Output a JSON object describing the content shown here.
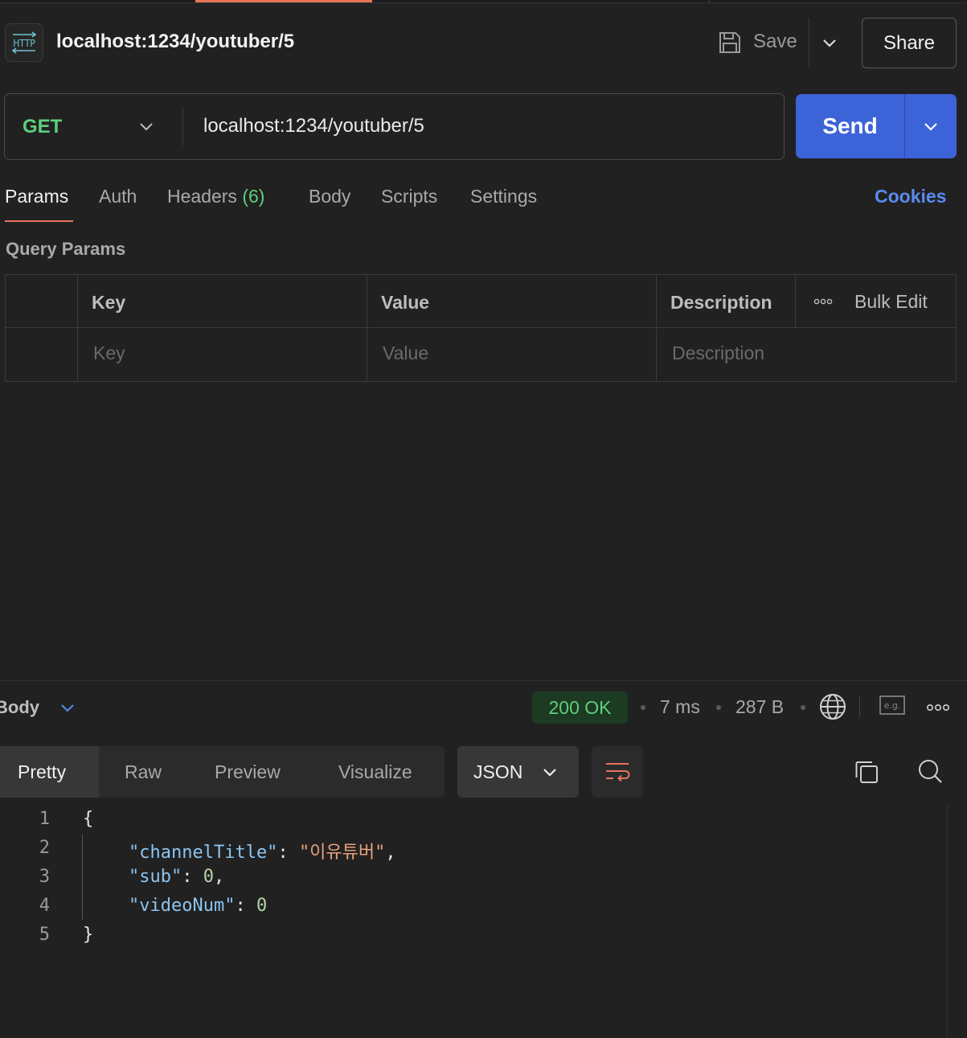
{
  "header": {
    "request_icon_text": "HTTP",
    "request_title": "localhost:1234/youtuber/5",
    "save_label": "Save",
    "share_label": "Share"
  },
  "request": {
    "method": "GET",
    "url": "localhost:1234/youtuber/5",
    "send_label": "Send"
  },
  "tabs": {
    "params": "Params",
    "auth": "Auth",
    "headers": "Headers",
    "headers_count": "(6)",
    "body": "Body",
    "scripts": "Scripts",
    "settings": "Settings",
    "cookies": "Cookies",
    "active": "Params"
  },
  "query_params": {
    "title": "Query Params",
    "columns": [
      "Key",
      "Value",
      "Description"
    ],
    "bulk_edit": "Bulk Edit",
    "placeholders": {
      "key": "Key",
      "value": "Value",
      "description": "Description"
    }
  },
  "response": {
    "section_label": "Body",
    "status": "200 OK",
    "time": "7 ms",
    "size": "287 B",
    "example_icon_text": "e.g.",
    "views": [
      "Pretty",
      "Raw",
      "Preview",
      "Visualize"
    ],
    "active_view": "Pretty",
    "format": "JSON",
    "line_numbers": [
      "1",
      "2",
      "3",
      "4",
      "5"
    ],
    "json": {
      "open": "{",
      "close": "}",
      "fields": [
        {
          "key": "\"channelTitle\"",
          "value": "\"이유튜버\"",
          "trail": ","
        },
        {
          "key": "\"sub\"",
          "value": "0",
          "trail": ","
        },
        {
          "key": "\"videoNum\"",
          "value": "0",
          "trail": ""
        }
      ]
    }
  },
  "colors": {
    "accent_orange": "#e8745a",
    "send_blue": "#3d63d8",
    "method_green": "#5fce7d",
    "link_blue": "#5b8af0",
    "json_key": "#8cc4f0",
    "json_string": "#e8a17a"
  }
}
